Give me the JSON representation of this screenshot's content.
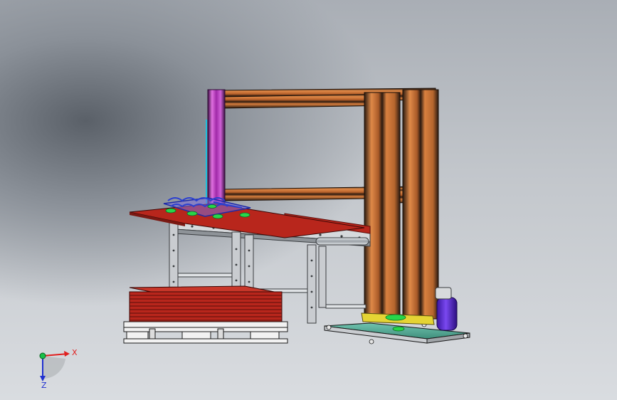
{
  "viewport": {
    "type": "3d-model-view",
    "background": [
      "#5a6068",
      "#a9aeb5",
      "#d9dce0"
    ]
  },
  "colors": {
    "frame_orange": "#d2773a",
    "frame_dark": "#2b1a10",
    "column_magenta": "#c640c8",
    "sheet_red": "#b8261c",
    "conveyor_steel": "#c9ccd0",
    "gripper_blue": "#2b3fd0",
    "suction_green": "#27d64a",
    "base_plate": "#5fb3a0",
    "base_yellow": "#e5d434",
    "motor_purple": "#5b28d6",
    "pallet_white": "#f2f2f2"
  },
  "triad": {
    "x_label": "X",
    "z_label": "Z",
    "x_color": "#e02020",
    "z_color": "#2030d0",
    "origin_color": "#18c048"
  }
}
